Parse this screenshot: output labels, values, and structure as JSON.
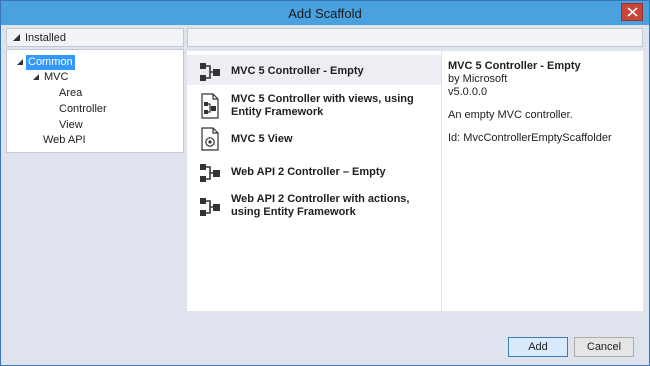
{
  "window": {
    "title": "Add Scaffold"
  },
  "left_header": {
    "label": "Installed"
  },
  "tree": {
    "common": "Common",
    "mvc": "MVC",
    "area": "Area",
    "controller": "Controller",
    "view": "View",
    "webapi": "Web API"
  },
  "items": [
    {
      "label": "MVC 5 Controller - Empty",
      "icon": "controller-icon"
    },
    {
      "label": "MVC 5 Controller with views, using Entity Framework",
      "icon": "controller-views-icon"
    },
    {
      "label": "MVC 5 View",
      "icon": "view-file-icon"
    },
    {
      "label": "Web API 2 Controller – Empty",
      "icon": "controller-icon"
    },
    {
      "label": "Web API 2 Controller with actions, using Entity Framework",
      "icon": "controller-icon"
    }
  ],
  "details": {
    "title": "MVC 5 Controller - Empty",
    "author": "by Microsoft",
    "version": "v5.0.0.0",
    "description": "An empty MVC controller.",
    "id": "Id: MvcControllerEmptyScaffolder"
  },
  "buttons": {
    "add": "Add",
    "cancel": "Cancel"
  },
  "colors": {
    "titlebar": "#4aa1e0",
    "selection": "#3399ff",
    "close": "#c9453a"
  }
}
